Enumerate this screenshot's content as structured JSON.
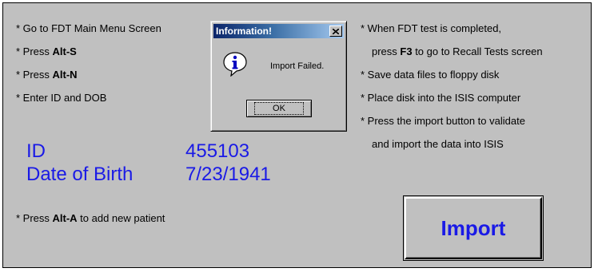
{
  "left_steps": [
    {
      "prefix": "* Go to FDT Main Menu Screen",
      "key": "",
      "suffix": ""
    },
    {
      "prefix": "* Press ",
      "key": "Alt-S",
      "suffix": ""
    },
    {
      "prefix": "* Press ",
      "key": "Alt-N",
      "suffix": ""
    },
    {
      "prefix": "* Enter ID and DOB",
      "key": "",
      "suffix": ""
    }
  ],
  "right_steps": {
    "line1": "* When FDT test is completed,",
    "line2_prefix": "press ",
    "line2_key": "F3",
    "line2_suffix": " to go to Recall Tests screen",
    "line3": "* Save data files to floppy disk",
    "line4": "* Place disk into the ISIS computer",
    "line5": "* Press the import button to validate",
    "line6": "and import the data into ISIS"
  },
  "patient": {
    "id_label": "ID",
    "id_value": "455103",
    "dob_label": "Date of Birth",
    "dob_value": "7/23/1941"
  },
  "add_patient": {
    "prefix": "* Press ",
    "key": "Alt-A",
    "suffix": " to add new patient"
  },
  "import_button": {
    "label": "Import"
  },
  "dialog": {
    "title": "Information!",
    "message": "Import Failed.",
    "ok_label": "OK",
    "icon": "information-icon"
  },
  "colors": {
    "background": "#c0c0c0",
    "accent_blue": "#1a1ae6",
    "title_bar": "#0a246a"
  }
}
